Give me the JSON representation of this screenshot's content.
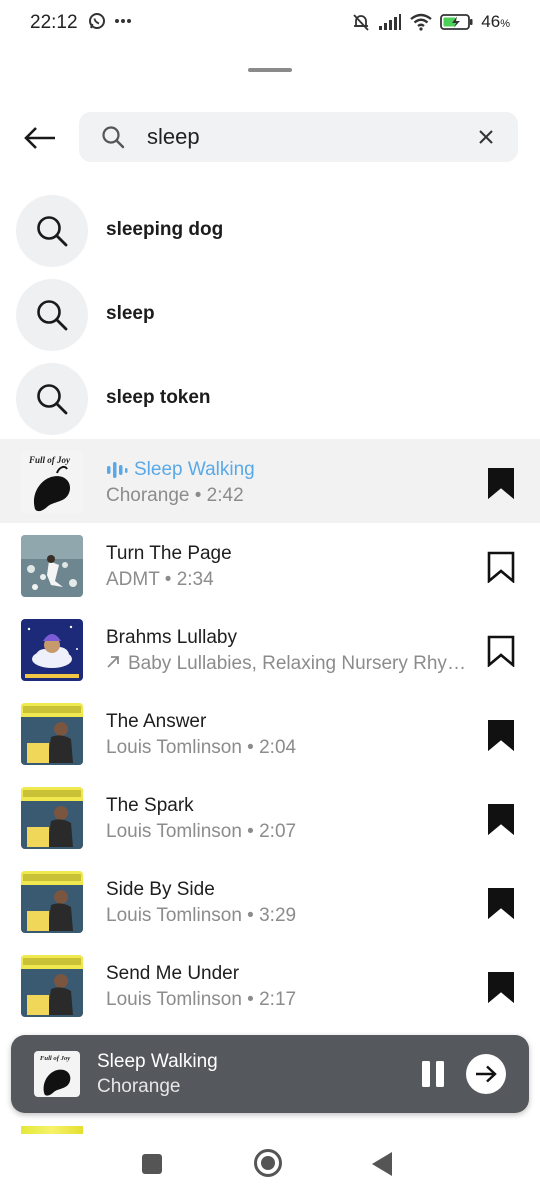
{
  "status_bar": {
    "time": "22:12",
    "battery_percent": "46",
    "battery_unit": "%",
    "icons": [
      "whatsapp-icon",
      "more-dots-icon",
      "bell-muted-icon",
      "signal-icon",
      "wifi-icon",
      "battery-charging-icon"
    ]
  },
  "search": {
    "query": "sleep"
  },
  "suggestions": [
    {
      "label": "sleeping dog"
    },
    {
      "label": "sleep"
    },
    {
      "label": "sleep token"
    }
  ],
  "tracks": [
    {
      "title": "Sleep Walking",
      "subtitle": "Chorange • 2:42",
      "playing": true,
      "saved": true,
      "art_text": "Full of Joy"
    },
    {
      "title": "Turn The Page",
      "subtitle": "ADMT • 2:34",
      "playing": false,
      "saved": false
    },
    {
      "title": "Brahms Lullaby",
      "subtitle": "Baby Lullabies, Relaxing Nursery Rhymes",
      "playing": false,
      "saved": false,
      "trending": true
    },
    {
      "title": "The Answer",
      "subtitle": "Louis Tomlinson • 2:04",
      "playing": false,
      "saved": true
    },
    {
      "title": "The Spark",
      "subtitle": "Louis Tomlinson • 2:07",
      "playing": false,
      "saved": true
    },
    {
      "title": "Side By Side",
      "subtitle": "Louis Tomlinson • 3:29",
      "playing": false,
      "saved": true
    },
    {
      "title": "Send Me Under",
      "subtitle": "Louis Tomlinson • 2:17",
      "playing": false,
      "saved": true
    }
  ],
  "mini_player": {
    "title": "Sleep Walking",
    "artist": "Chorange",
    "art_text": "Full of Joy"
  },
  "colors": {
    "active_accent": "#5aa9e6",
    "mini_player_bg": "#55585c",
    "highlight_row": "#f2f2f2"
  }
}
